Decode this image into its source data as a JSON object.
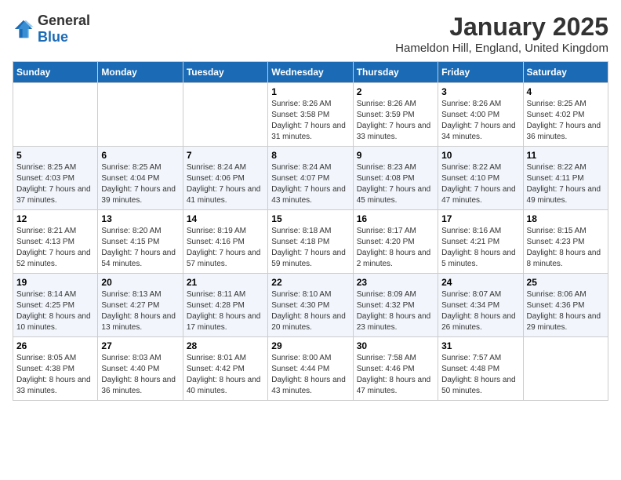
{
  "logo": {
    "general": "General",
    "blue": "Blue"
  },
  "title": "January 2025",
  "subtitle": "Hameldon Hill, England, United Kingdom",
  "headers": [
    "Sunday",
    "Monday",
    "Tuesday",
    "Wednesday",
    "Thursday",
    "Friday",
    "Saturday"
  ],
  "weeks": [
    [
      {
        "day": "",
        "sunrise": "",
        "sunset": "",
        "daylight": ""
      },
      {
        "day": "",
        "sunrise": "",
        "sunset": "",
        "daylight": ""
      },
      {
        "day": "",
        "sunrise": "",
        "sunset": "",
        "daylight": ""
      },
      {
        "day": "1",
        "sunrise": "Sunrise: 8:26 AM",
        "sunset": "Sunset: 3:58 PM",
        "daylight": "Daylight: 7 hours and 31 minutes."
      },
      {
        "day": "2",
        "sunrise": "Sunrise: 8:26 AM",
        "sunset": "Sunset: 3:59 PM",
        "daylight": "Daylight: 7 hours and 33 minutes."
      },
      {
        "day": "3",
        "sunrise": "Sunrise: 8:26 AM",
        "sunset": "Sunset: 4:00 PM",
        "daylight": "Daylight: 7 hours and 34 minutes."
      },
      {
        "day": "4",
        "sunrise": "Sunrise: 8:25 AM",
        "sunset": "Sunset: 4:02 PM",
        "daylight": "Daylight: 7 hours and 36 minutes."
      }
    ],
    [
      {
        "day": "5",
        "sunrise": "Sunrise: 8:25 AM",
        "sunset": "Sunset: 4:03 PM",
        "daylight": "Daylight: 7 hours and 37 minutes."
      },
      {
        "day": "6",
        "sunrise": "Sunrise: 8:25 AM",
        "sunset": "Sunset: 4:04 PM",
        "daylight": "Daylight: 7 hours and 39 minutes."
      },
      {
        "day": "7",
        "sunrise": "Sunrise: 8:24 AM",
        "sunset": "Sunset: 4:06 PM",
        "daylight": "Daylight: 7 hours and 41 minutes."
      },
      {
        "day": "8",
        "sunrise": "Sunrise: 8:24 AM",
        "sunset": "Sunset: 4:07 PM",
        "daylight": "Daylight: 7 hours and 43 minutes."
      },
      {
        "day": "9",
        "sunrise": "Sunrise: 8:23 AM",
        "sunset": "Sunset: 4:08 PM",
        "daylight": "Daylight: 7 hours and 45 minutes."
      },
      {
        "day": "10",
        "sunrise": "Sunrise: 8:22 AM",
        "sunset": "Sunset: 4:10 PM",
        "daylight": "Daylight: 7 hours and 47 minutes."
      },
      {
        "day": "11",
        "sunrise": "Sunrise: 8:22 AM",
        "sunset": "Sunset: 4:11 PM",
        "daylight": "Daylight: 7 hours and 49 minutes."
      }
    ],
    [
      {
        "day": "12",
        "sunrise": "Sunrise: 8:21 AM",
        "sunset": "Sunset: 4:13 PM",
        "daylight": "Daylight: 7 hours and 52 minutes."
      },
      {
        "day": "13",
        "sunrise": "Sunrise: 8:20 AM",
        "sunset": "Sunset: 4:15 PM",
        "daylight": "Daylight: 7 hours and 54 minutes."
      },
      {
        "day": "14",
        "sunrise": "Sunrise: 8:19 AM",
        "sunset": "Sunset: 4:16 PM",
        "daylight": "Daylight: 7 hours and 57 minutes."
      },
      {
        "day": "15",
        "sunrise": "Sunrise: 8:18 AM",
        "sunset": "Sunset: 4:18 PM",
        "daylight": "Daylight: 7 hours and 59 minutes."
      },
      {
        "day": "16",
        "sunrise": "Sunrise: 8:17 AM",
        "sunset": "Sunset: 4:20 PM",
        "daylight": "Daylight: 8 hours and 2 minutes."
      },
      {
        "day": "17",
        "sunrise": "Sunrise: 8:16 AM",
        "sunset": "Sunset: 4:21 PM",
        "daylight": "Daylight: 8 hours and 5 minutes."
      },
      {
        "day": "18",
        "sunrise": "Sunrise: 8:15 AM",
        "sunset": "Sunset: 4:23 PM",
        "daylight": "Daylight: 8 hours and 8 minutes."
      }
    ],
    [
      {
        "day": "19",
        "sunrise": "Sunrise: 8:14 AM",
        "sunset": "Sunset: 4:25 PM",
        "daylight": "Daylight: 8 hours and 10 minutes."
      },
      {
        "day": "20",
        "sunrise": "Sunrise: 8:13 AM",
        "sunset": "Sunset: 4:27 PM",
        "daylight": "Daylight: 8 hours and 13 minutes."
      },
      {
        "day": "21",
        "sunrise": "Sunrise: 8:11 AM",
        "sunset": "Sunset: 4:28 PM",
        "daylight": "Daylight: 8 hours and 17 minutes."
      },
      {
        "day": "22",
        "sunrise": "Sunrise: 8:10 AM",
        "sunset": "Sunset: 4:30 PM",
        "daylight": "Daylight: 8 hours and 20 minutes."
      },
      {
        "day": "23",
        "sunrise": "Sunrise: 8:09 AM",
        "sunset": "Sunset: 4:32 PM",
        "daylight": "Daylight: 8 hours and 23 minutes."
      },
      {
        "day": "24",
        "sunrise": "Sunrise: 8:07 AM",
        "sunset": "Sunset: 4:34 PM",
        "daylight": "Daylight: 8 hours and 26 minutes."
      },
      {
        "day": "25",
        "sunrise": "Sunrise: 8:06 AM",
        "sunset": "Sunset: 4:36 PM",
        "daylight": "Daylight: 8 hours and 29 minutes."
      }
    ],
    [
      {
        "day": "26",
        "sunrise": "Sunrise: 8:05 AM",
        "sunset": "Sunset: 4:38 PM",
        "daylight": "Daylight: 8 hours and 33 minutes."
      },
      {
        "day": "27",
        "sunrise": "Sunrise: 8:03 AM",
        "sunset": "Sunset: 4:40 PM",
        "daylight": "Daylight: 8 hours and 36 minutes."
      },
      {
        "day": "28",
        "sunrise": "Sunrise: 8:01 AM",
        "sunset": "Sunset: 4:42 PM",
        "daylight": "Daylight: 8 hours and 40 minutes."
      },
      {
        "day": "29",
        "sunrise": "Sunrise: 8:00 AM",
        "sunset": "Sunset: 4:44 PM",
        "daylight": "Daylight: 8 hours and 43 minutes."
      },
      {
        "day": "30",
        "sunrise": "Sunrise: 7:58 AM",
        "sunset": "Sunset: 4:46 PM",
        "daylight": "Daylight: 8 hours and 47 minutes."
      },
      {
        "day": "31",
        "sunrise": "Sunrise: 7:57 AM",
        "sunset": "Sunset: 4:48 PM",
        "daylight": "Daylight: 8 hours and 50 minutes."
      },
      {
        "day": "",
        "sunrise": "",
        "sunset": "",
        "daylight": ""
      }
    ]
  ]
}
